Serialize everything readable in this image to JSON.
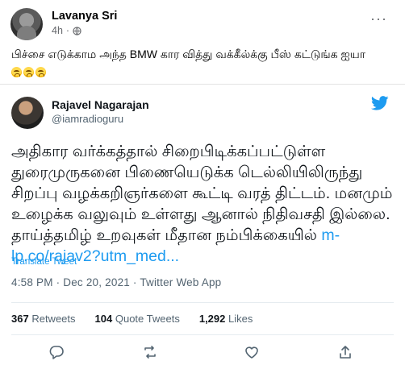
{
  "post": {
    "author": "Lavanya Sri",
    "time": "4h",
    "more": "···",
    "caption": "பிச்சை எடுக்காம அந்த BMW கார வித்து வக்கீல்க்கு பீஸ் கட்டுங்க ஐயா",
    "emojis": [
      "sad-emoji-icon",
      "sad-emoji-icon",
      "sad-emoji-icon"
    ]
  },
  "tweet": {
    "name": "Rajavel Nagarajan",
    "handle": "@iamradioguru",
    "body": "அதிகார வர்க்கத்தால் சிறைபிடிக்கப்பட்டுள்ள துரைமுருகனை பிணையெடுக்க டெல்லியிலிருந்து சிறப்பு வழக்கறிஞர்களை கூட்டி வரத் திட்டம். மனமும் உழைக்க வலுவும் உள்ளது ஆனால் நிதிவசதி இல்லை. தாய்த்தமிழ் உறவுகள் மீதான நம்பிக்கையில் ",
    "link": "m-lp.co/rajav2?utm_med...",
    "translate": "Translate Tweet",
    "timestamp": "4:58 PM · Dec 20, 2021 · Twitter Web App",
    "stats": {
      "retweets_count": "367",
      "retweets_label": "Retweets",
      "quotes_count": "104",
      "quotes_label": "Quote Tweets",
      "likes_count": "1,292",
      "likes_label": "Likes"
    },
    "accent": "#1d9bf0"
  }
}
